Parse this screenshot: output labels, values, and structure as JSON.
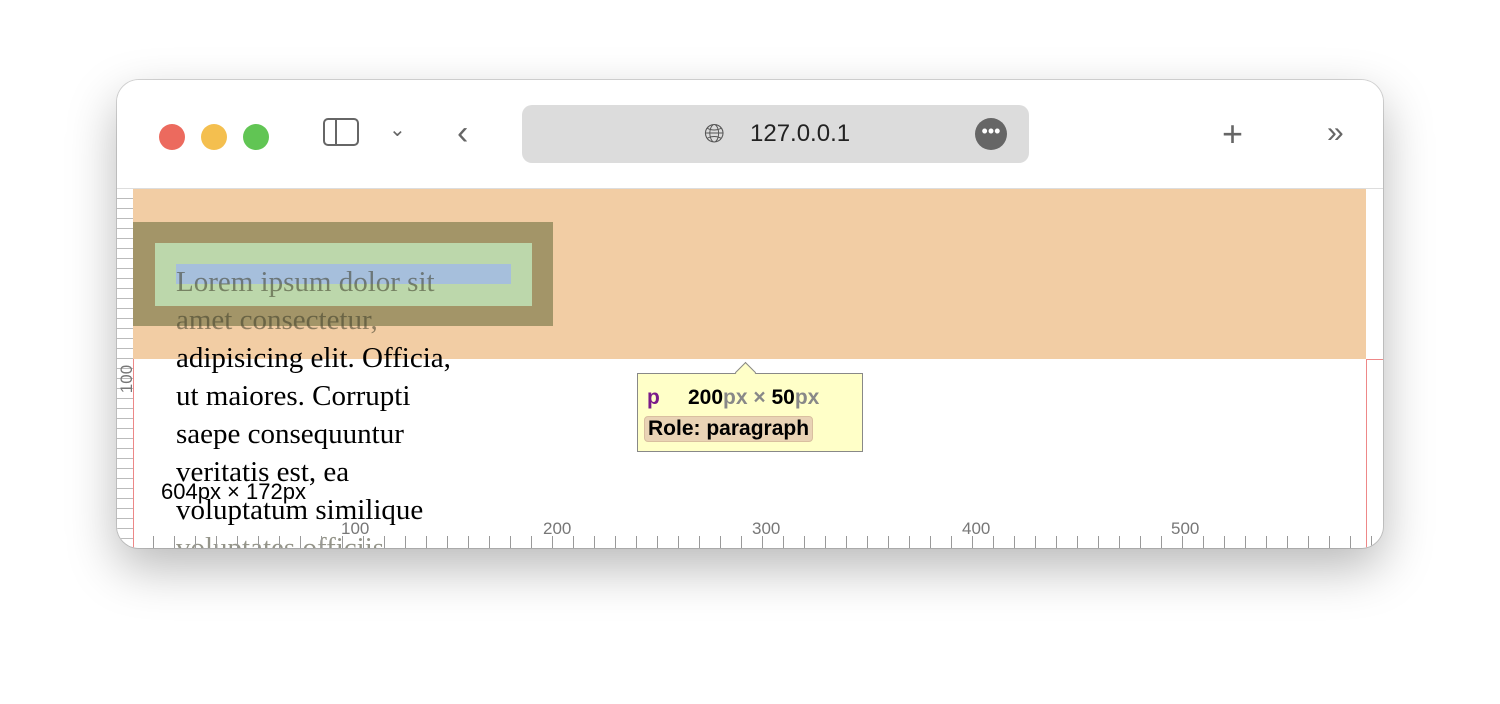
{
  "browser": {
    "url": "127.0.0.1",
    "traffic_lights": [
      "#ec6a5e",
      "#f4bf4f",
      "#61c554"
    ]
  },
  "page": {
    "lines": [
      "Lorem ipsum dolor sit",
      "amet consectetur,",
      "adipisicing elit. Officia,",
      "ut maiores. Corrupti",
      "saepe consequuntur",
      "veritatis est, ea",
      "voluptatum similique",
      "voluptates officiis"
    ]
  },
  "inspector": {
    "tag": "p",
    "width": "200",
    "height": "50",
    "unit": "px",
    "times": " × ",
    "role": "Role: paragraph",
    "container_size": "604px × 172px"
  },
  "rulers": {
    "left": [
      "100"
    ],
    "bottom": [
      "100",
      "200",
      "300",
      "400",
      "500"
    ]
  }
}
